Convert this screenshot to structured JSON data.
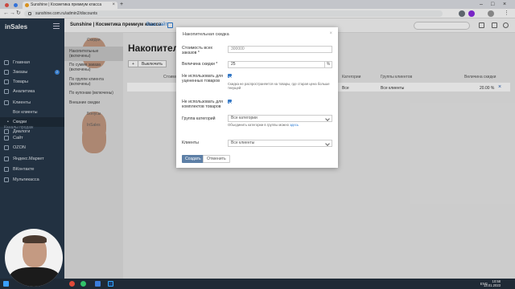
{
  "browser": {
    "tab_title": "Sunshine | Косметика премиум класса",
    "url": "sunshine.com.ru/admin2/discounts"
  },
  "sidebar": {
    "logo": "inSales",
    "items": [
      {
        "label": "Главная"
      },
      {
        "label": "Заказы",
        "badge": "2"
      },
      {
        "label": "Товары"
      },
      {
        "label": "Аналитика"
      },
      {
        "label": "Клиенты"
      },
      {
        "label": "Все клиенты"
      },
      {
        "label": "Скидки"
      },
      {
        "label": "Диалоги"
      }
    ],
    "channels_heading": "Каналы продаж",
    "channels": [
      {
        "label": "Сайт"
      },
      {
        "label": "OZON"
      },
      {
        "label": "Яндекс.Маркет"
      },
      {
        "label": "ВКонтакте"
      },
      {
        "label": "Мультикасса"
      }
    ]
  },
  "appbar": {
    "shop_name": "Sunshine | Косметика премиум класса",
    "site_link": "Ваш сайт"
  },
  "discount_panel": {
    "heading": "Скидки",
    "items": [
      {
        "label": "Накопительные (включены)"
      },
      {
        "label": "По сумме заказа (включены)"
      },
      {
        "label": "По группе клиента (включены)"
      },
      {
        "label": "По купонам (включены)"
      },
      {
        "label": "Внешние скидки"
      }
    ],
    "bonuses": "Бонусы",
    "insales": "InSales"
  },
  "main": {
    "title": "Накопительные",
    "add_button": "+",
    "disable_button": "Выключить",
    "columns": [
      "Стоимость",
      "Категории",
      "Группы клиентов",
      "Величина скидки"
    ],
    "row": {
      "categories": "Все",
      "groups": "Все клиенты",
      "discount": "20.00 %",
      "delete": "×"
    }
  },
  "modal": {
    "title": "Накопительная скидка",
    "close": "×",
    "order_total_label": "Стоимость всех заказов *",
    "order_total_placeholder": "300000",
    "discount_label": "Величина скидки *",
    "discount_value": "25",
    "discount_suffix": "%",
    "no_discounted_label": "Не использовать для уцененных товаров",
    "no_discounted_hint": "Скидка не распространяется на товары, где старая цена больше текущей",
    "no_bundles_label": "Не использовать для комплектов товаров",
    "category_group_label": "Группа категорий",
    "category_group_value": "Все категории",
    "category_hint": "Объединить категории в группы можно",
    "category_hint_link": "здесь",
    "clients_label": "Клиенты",
    "clients_value": "Все клиенты",
    "create_button": "Создать",
    "cancel_button": "Отменить"
  },
  "taskbar": {
    "lang": "ENG",
    "time": "10:58",
    "date": "13.01.2023"
  }
}
